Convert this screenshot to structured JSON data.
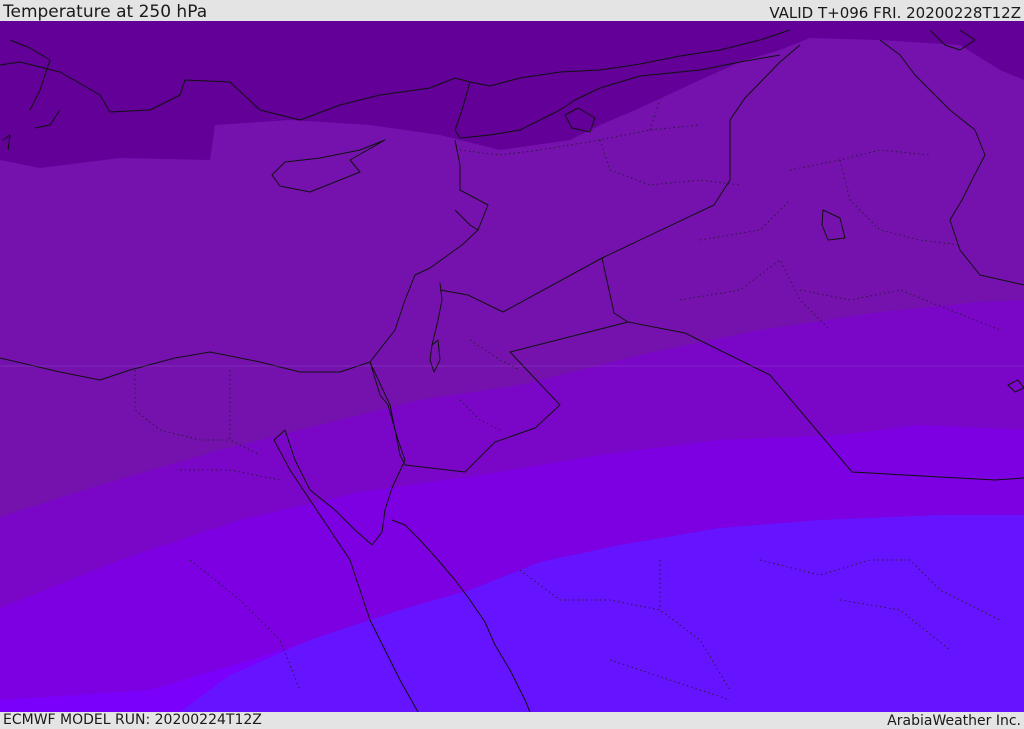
{
  "header": {
    "title": "Temperature at 250 hPa",
    "valid": "VALID T+096 FRI. 20200228T12Z"
  },
  "footer": {
    "model_run": "ECMWF MODEL RUN: 20200224T12Z",
    "credit": "ArabiaWeather Inc."
  },
  "map": {
    "bands": [
      {
        "name": "coldest",
        "color": "#620098"
      },
      {
        "name": "cold",
        "color": "#7512ae"
      },
      {
        "name": "cool",
        "color": "#7a06c8"
      },
      {
        "name": "mid",
        "color": "#7c00e2"
      },
      {
        "name": "warm",
        "color": "#7a00fb"
      },
      {
        "name": "warmest",
        "color": "#6614ff"
      }
    ],
    "line_color": "#111111"
  }
}
